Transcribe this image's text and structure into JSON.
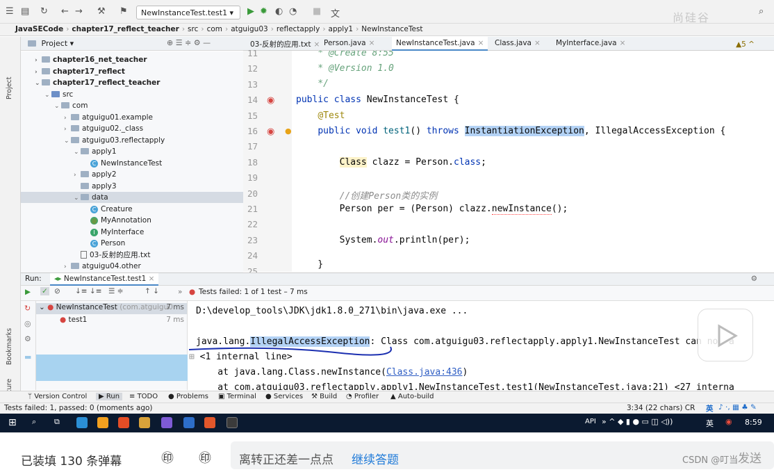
{
  "toolbar": {
    "run_config": "NewInstanceTest.test1",
    "watermark": "尚硅谷"
  },
  "breadcrumb": [
    "JavaSECode",
    "chapter17_reflect_teacher",
    "src",
    "com",
    "atguigu03",
    "reflectapply",
    "apply1",
    "NewInstanceTest"
  ],
  "stripe": {
    "project": "Project",
    "bookmarks": "Bookmarks",
    "structure": "Structure"
  },
  "project": {
    "title": "Project",
    "tree": [
      {
        "label": "chapter16_net_teacher",
        "depth": 1,
        "icon": "module",
        "chev": "›",
        "bold": true
      },
      {
        "label": "chapter17_reflect",
        "depth": 1,
        "icon": "module",
        "chev": "›",
        "bold": true
      },
      {
        "label": "chapter17_reflect_teacher",
        "depth": 1,
        "icon": "module",
        "chev": "⌄",
        "bold": true
      },
      {
        "label": "src",
        "depth": 2,
        "icon": "src",
        "chev": "⌄"
      },
      {
        "label": "com",
        "depth": 3,
        "icon": "folder",
        "chev": "⌄"
      },
      {
        "label": "atguigu01.example",
        "depth": 4,
        "icon": "folder",
        "chev": "›"
      },
      {
        "label": "atguigu02._class",
        "depth": 4,
        "icon": "folder",
        "chev": "›"
      },
      {
        "label": "atguigu03.reflectapply",
        "depth": 4,
        "icon": "folder",
        "chev": "⌄"
      },
      {
        "label": "apply1",
        "depth": 5,
        "icon": "folder",
        "chev": "⌄"
      },
      {
        "label": "NewInstanceTest",
        "depth": 6,
        "icon": "class",
        "chev": ""
      },
      {
        "label": "apply2",
        "depth": 5,
        "icon": "folder",
        "chev": "›"
      },
      {
        "label": "apply3",
        "depth": 5,
        "icon": "folder",
        "chev": ""
      },
      {
        "label": "data",
        "depth": 5,
        "icon": "folder",
        "chev": "⌄",
        "selected": true
      },
      {
        "label": "Creature",
        "depth": 6,
        "icon": "class",
        "chev": ""
      },
      {
        "label": "MyAnnotation",
        "depth": 6,
        "icon": "annotation",
        "chev": ""
      },
      {
        "label": "MyInterface",
        "depth": 6,
        "icon": "interface",
        "chev": ""
      },
      {
        "label": "Person",
        "depth": 6,
        "icon": "class",
        "chev": ""
      },
      {
        "label": "03-反射的应用.txt",
        "depth": 5,
        "icon": "text",
        "chev": ""
      },
      {
        "label": "atguigu04.other",
        "depth": 4,
        "icon": "folder",
        "chev": "›"
      }
    ]
  },
  "editor": {
    "tabs": [
      {
        "label": "03-反射的应用.txt",
        "active": false
      },
      {
        "label": "Person.java",
        "active": false
      },
      {
        "label": "NewInstanceTest.java",
        "active": true
      },
      {
        "label": "Class.java",
        "active": false
      },
      {
        "label": "MyInterface.java",
        "active": false
      }
    ],
    "warnings": "▲5 ^",
    "line_numbers": [
      "11",
      "12",
      "13",
      "14",
      "15",
      "16",
      "17",
      "18",
      "19",
      "20",
      "21",
      "22",
      "23",
      "24",
      "25"
    ]
  },
  "run": {
    "label": "Run:",
    "tab": "NewInstanceTest.test1",
    "status": "Tests failed: 1 of 1 test – 7 ms",
    "test_root": "NewInstanceTest",
    "test_root_pkg": "(com.atguigu0",
    "test_root_time": "7 ms",
    "test_child": "test1",
    "test_child_time": "7 ms",
    "console": {
      "line1": "D:\\develop_tools\\JDK\\jdk1.8.0_271\\bin\\java.exe ...",
      "ex_prefix": "java.lang.",
      "ex_name": "IllegalAccessException",
      "ex_rest": ": Class com.atguigu03.reflectapply.apply1.NewInstanceTest can not a",
      "internal": "<1 internal line>",
      "at1_prefix": "    at java.lang.Class.newInstance(",
      "at1_link": "Class.java:436",
      "at1_suffix": ")",
      "at2": "    at com.atguigu03.reflectapply.apply1.NewInstanceTest.test1(NewInstanceTest.java:21) <27 interna"
    }
  },
  "toolstrip": [
    "Version Control",
    "Run",
    "TODO",
    "Problems",
    "Terminal",
    "Services",
    "Build",
    "Profiler",
    "Auto-build"
  ],
  "statusbar": {
    "left": "Tests failed: 1, passed: 0 (moments ago)",
    "right": "3:34 (22 chars)  CR",
    "ime": "英"
  },
  "taskbar": {
    "api": "API",
    "lang": "英",
    "time": "8:59"
  },
  "danmaku": {
    "count_text": "已装填 130 条弹幕",
    "tip_text": "离转正还差一点点",
    "link_text": "继续答题",
    "credit": "CSDN @叮当",
    "send": "发送"
  }
}
